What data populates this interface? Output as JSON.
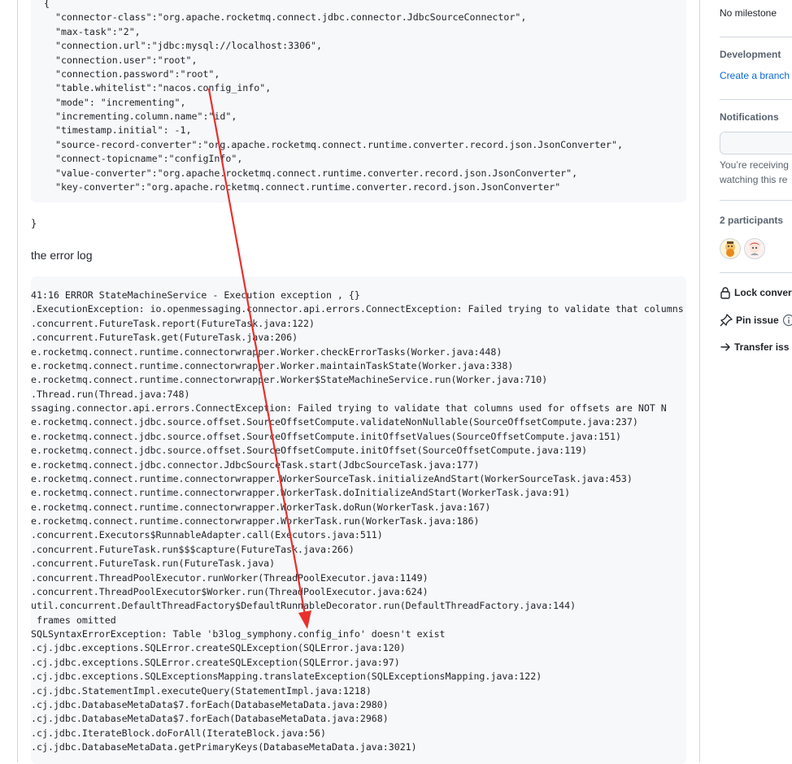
{
  "config_code": [
    "{",
    "  \"connector-class\":\"org.apache.rocketmq.connect.jdbc.connector.JdbcSourceConnector\",",
    "  \"max-task\":\"2\",",
    "  \"connection.url\":\"jdbc:mysql://localhost:3306\",",
    "  \"connection.user\":\"root\",",
    "  \"connection.password\":\"root\",",
    "  \"table.whitelist\":\"nacos.config_info\",",
    "  \"mode\": \"incrementing\",",
    "  \"incrementing.column.name\":\"id\",",
    "  \"timestamp.initial\": -1,",
    "  \"source-record-converter\":\"org.apache.rocketmq.connect.runtime.converter.record.json.JsonConverter\",",
    "  \"connect-topicname\":\"configInfo\",",
    "  \"value-converter\":\"org.apache.rocketmq.connect.runtime.converter.record.json.JsonConverter\",",
    "  \"key-converter\":\"org.apache.rocketmq.connect.runtime.converter.record.json.JsonConverter\""
  ],
  "closing_brace": "}",
  "paragraph": "the error log",
  "error_log": [
    "41:16 ERROR StateMachineService - Execution exception , {}",
    ".ExecutionException: io.openmessaging.connector.api.errors.ConnectException: Failed trying to validate that columns used for offsets are NOT N",
    ".concurrent.FutureTask.report(FutureTask.java:122)",
    ".concurrent.FutureTask.get(FutureTask.java:206)",
    "e.rocketmq.connect.runtime.connectorwrapper.Worker.checkErrorTasks(Worker.java:448)",
    "e.rocketmq.connect.runtime.connectorwrapper.Worker.maintainTaskState(Worker.java:338)",
    "e.rocketmq.connect.runtime.connectorwrapper.Worker$StateMachineService.run(Worker.java:710)",
    ".Thread.run(Thread.java:748)",
    "ssaging.connector.api.errors.ConnectException: Failed trying to validate that columns used for offsets are NOT N",
    "e.rocketmq.connect.jdbc.source.offset.SourceOffsetCompute.validateNonNullable(SourceOffsetCompute.java:237)",
    "e.rocketmq.connect.jdbc.source.offset.SourceOffsetCompute.initOffsetValues(SourceOffsetCompute.java:151)",
    "e.rocketmq.connect.jdbc.source.offset.SourceOffsetCompute.initOffset(SourceOffsetCompute.java:119)",
    "e.rocketmq.connect.jdbc.connector.JdbcSourceTask.start(JdbcSourceTask.java:177)",
    "e.rocketmq.connect.runtime.connectorwrapper.WorkerSourceTask.initializeAndStart(WorkerSourceTask.java:453)",
    "e.rocketmq.connect.runtime.connectorwrapper.WorkerTask.doInitializeAndStart(WorkerTask.java:91)",
    "e.rocketmq.connect.runtime.connectorwrapper.WorkerTask.doRun(WorkerTask.java:167)",
    "e.rocketmq.connect.runtime.connectorwrapper.WorkerTask.run(WorkerTask.java:186)",
    ".concurrent.Executors$RunnableAdapter.call(Executors.java:511)",
    ".concurrent.FutureTask.run$$$capture(FutureTask.java:266)",
    ".concurrent.FutureTask.run(FutureTask.java)",
    ".concurrent.ThreadPoolExecutor.runWorker(ThreadPoolExecutor.java:1149)",
    ".concurrent.ThreadPoolExecutor$Worker.run(ThreadPoolExecutor.java:624)",
    "util.concurrent.DefaultThreadFactory$DefaultRunnableDecorator.run(DefaultThreadFactory.java:144)",
    " frames omitted",
    "SQLSyntaxErrorException: Table 'b3log_symphony.config_info' doesn't exist",
    ".cj.jdbc.exceptions.SQLError.createSQLException(SQLError.java:120)",
    ".cj.jdbc.exceptions.SQLError.createSQLException(SQLError.java:97)",
    ".cj.jdbc.exceptions.SQLExceptionsMapping.translateException(SQLExceptionsMapping.java:122)",
    ".cj.jdbc.StatementImpl.executeQuery(StatementImpl.java:1218)",
    ".cj.jdbc.DatabaseMetaData$7.forEach(DatabaseMetaData.java:2980)",
    ".cj.jdbc.DatabaseMetaData$7.forEach(DatabaseMetaData.java:2968)",
    ".cj.jdbc.IterateBlock.doForAll(IterateBlock.java:56)",
    ".cj.jdbc.DatabaseMetaData.getPrimaryKeys(DatabaseMetaData.java:3021)"
  ],
  "sidebar": {
    "milestone": "No milestone",
    "development_heading": "Development",
    "development_link": "Create a branch",
    "notifications_heading": "Notifications",
    "notifications_line1": "You’re receiving",
    "notifications_line2": "watching this re",
    "participants_heading": "2 participants",
    "lock": "Lock conver",
    "pin": "Pin issue",
    "transfer": "Transfer iss"
  },
  "annotation_color": "#e8312e"
}
